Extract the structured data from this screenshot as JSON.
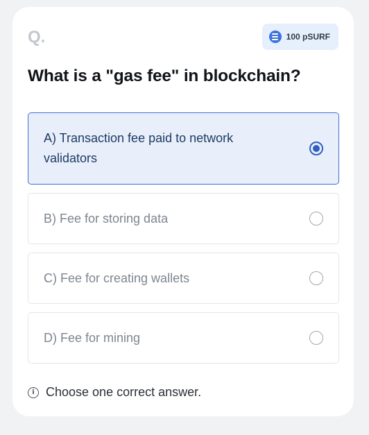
{
  "header": {
    "question_label": "Q.",
    "reward": {
      "text": "100 pSURF",
      "icon": "coin-icon"
    }
  },
  "question": {
    "text": "What is a \"gas fee\" in blockchain?"
  },
  "options": [
    {
      "text": "A) Transaction fee paid to network validators",
      "selected": true
    },
    {
      "text": "B) Fee for storing data",
      "selected": false
    },
    {
      "text": "C) Fee for creating wallets",
      "selected": false
    },
    {
      "text": "D) Fee for mining",
      "selected": false
    }
  ],
  "hint": {
    "icon": "info-icon",
    "text": "Choose one correct answer."
  },
  "colors": {
    "accent": "#2e5fbf",
    "selected_bg": "#e8effb",
    "badge_bg": "#e6effc"
  }
}
